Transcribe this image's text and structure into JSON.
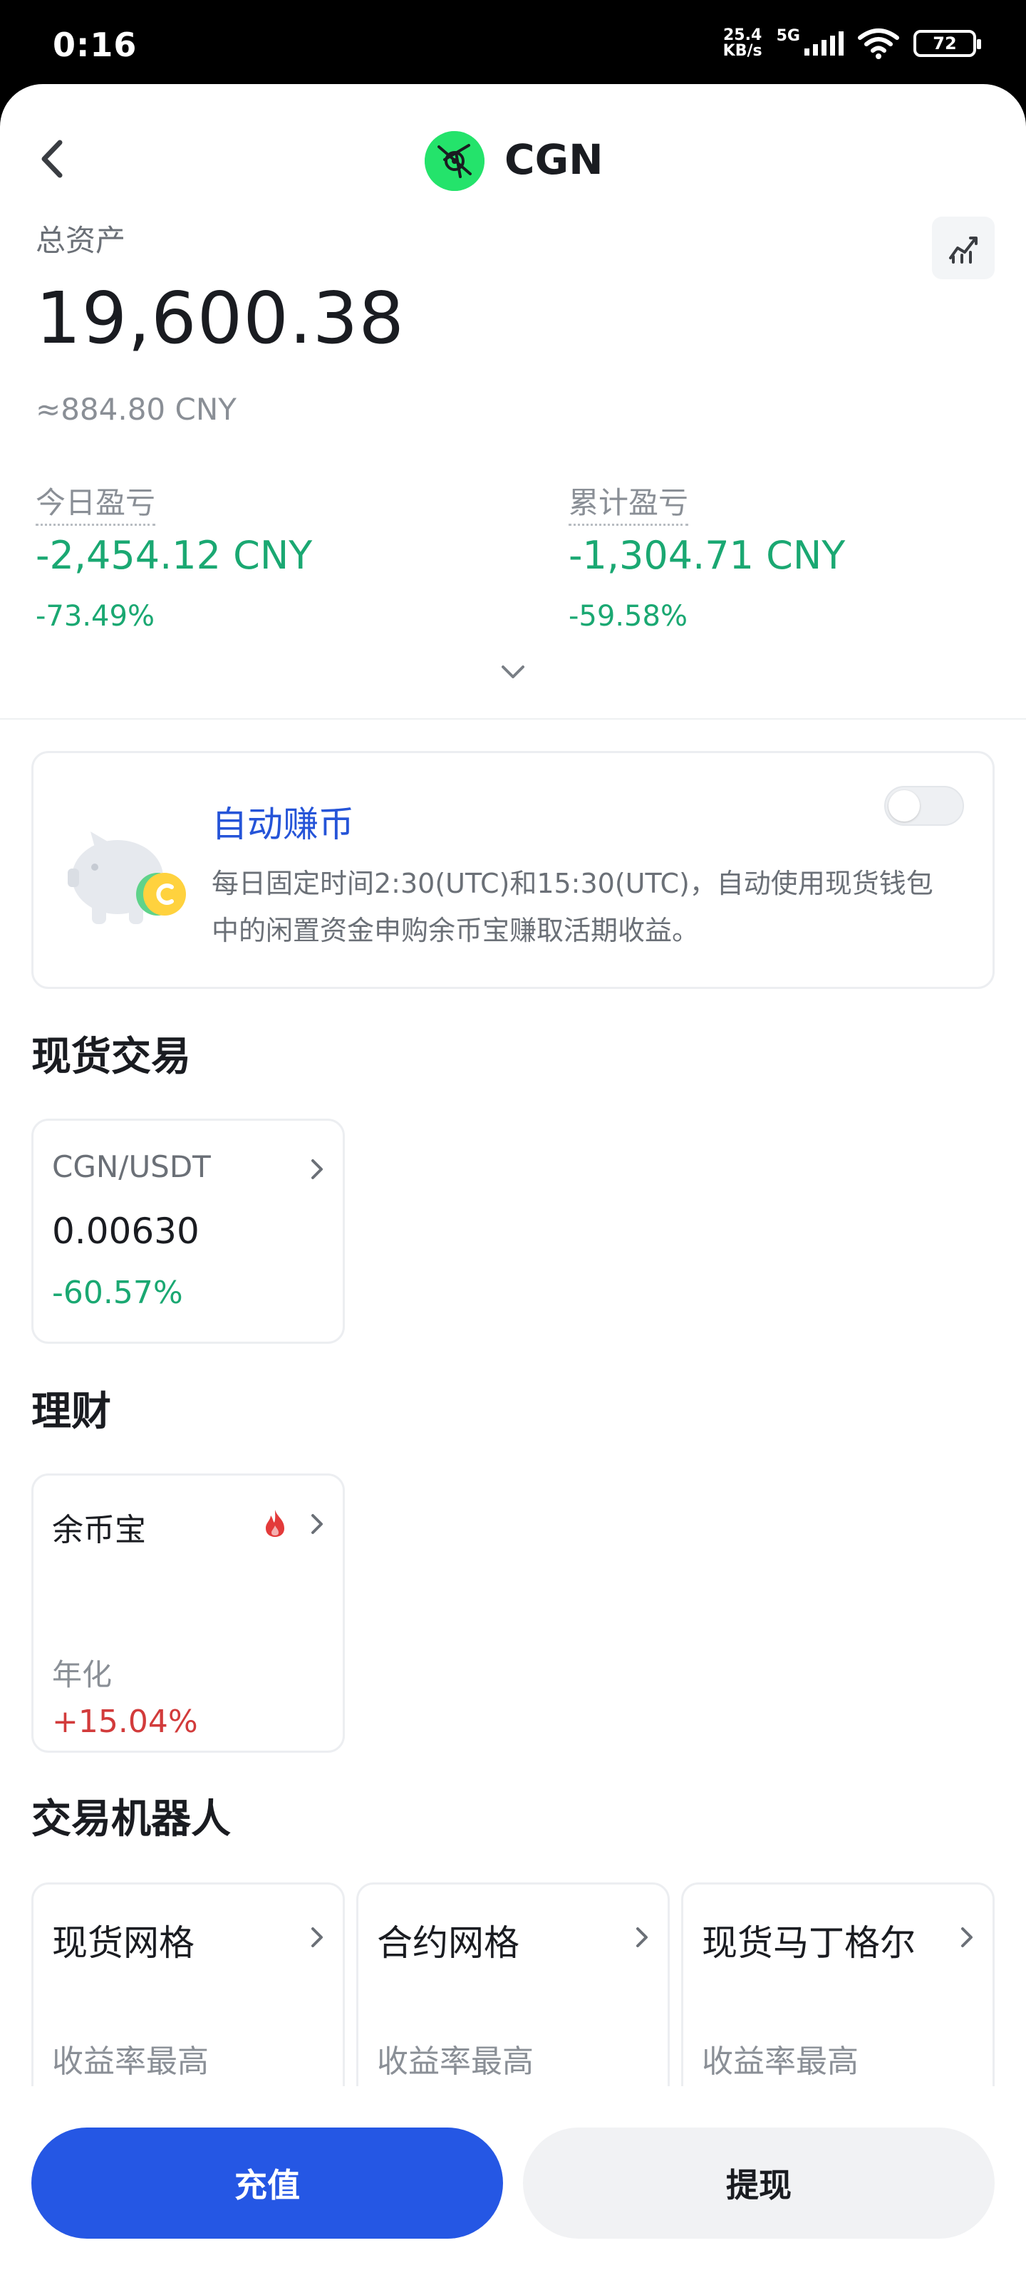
{
  "status_bar": {
    "time": "0:16",
    "net_speed_value": "25.4",
    "net_speed_unit": "KB/s",
    "network": "5G",
    "battery": "72"
  },
  "header": {
    "coin_name": "CGN",
    "coin_color": "#24e36b"
  },
  "assets": {
    "total_label": "总资产",
    "total_value": "19,600.38",
    "total_cny": "≈884.80 CNY",
    "today_label": "今日盈亏",
    "today_value": "-2,454.12 CNY",
    "today_pct": "-73.49%",
    "cumulative_label": "累计盈亏",
    "cumulative_value": "-1,304.71 CNY",
    "cumulative_pct": "-59.58%"
  },
  "auto_earn": {
    "title": "自动赚币",
    "description": "每日固定时间2:30(UTC)和15:30(UTC)，自动使用现货钱包中的闲置资金申购余币宝赚取活期收益。",
    "enabled": false
  },
  "spot": {
    "section_title": "现货交易",
    "pair": "CGN/USDT",
    "price": "0.00630",
    "change": "-60.57%"
  },
  "finance": {
    "section_title": "理财",
    "product": "余币宝",
    "rate_label": "年化",
    "rate": "+15.04%"
  },
  "bots": {
    "section_title": "交易机器人",
    "items": [
      {
        "name": "现货网格",
        "sub": "收益率最高"
      },
      {
        "name": "合约网格",
        "sub": "收益率最高"
      },
      {
        "name": "现货马丁格尔",
        "sub": "收益率最高"
      }
    ]
  },
  "actions": {
    "deposit": "充值",
    "withdraw": "提现"
  },
  "colors": {
    "accent": "#2557e4",
    "down": "#1aa872",
    "up": "#d23b3b"
  }
}
